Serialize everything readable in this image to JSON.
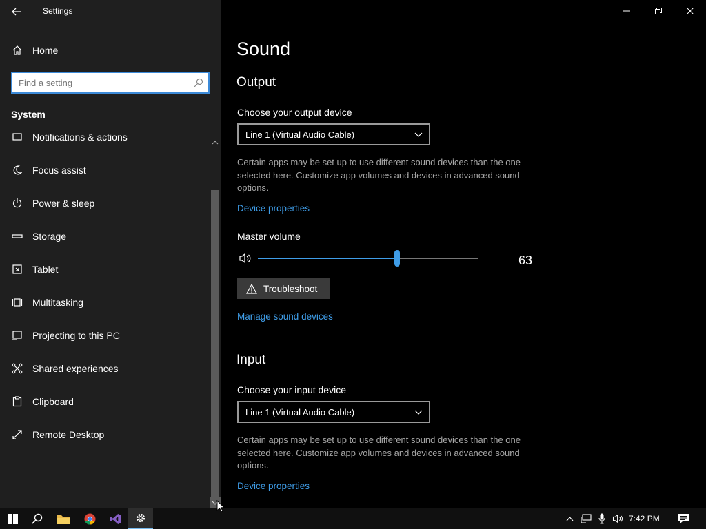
{
  "window": {
    "title": "Settings",
    "colors": {
      "accent": "#3f9de8",
      "sidebar_bg": "#1f1f1f",
      "main_bg": "#000000",
      "search_border": "#3c8ad8"
    }
  },
  "sidebar": {
    "home_label": "Home",
    "search_placeholder": "Find a setting",
    "section_title": "System",
    "items": [
      {
        "label": "Notifications & actions",
        "icon": "notifications-icon"
      },
      {
        "label": "Focus assist",
        "icon": "moon-icon"
      },
      {
        "label": "Power & sleep",
        "icon": "power-icon"
      },
      {
        "label": "Storage",
        "icon": "storage-icon"
      },
      {
        "label": "Tablet",
        "icon": "tablet-icon"
      },
      {
        "label": "Multitasking",
        "icon": "multitasking-icon"
      },
      {
        "label": "Projecting to this PC",
        "icon": "projecting-icon"
      },
      {
        "label": "Shared experiences",
        "icon": "shared-experiences-icon"
      },
      {
        "label": "Clipboard",
        "icon": "clipboard-icon"
      },
      {
        "label": "Remote Desktop",
        "icon": "remote-desktop-icon"
      }
    ]
  },
  "main": {
    "page_title": "Sound",
    "output": {
      "title": "Output",
      "device_label": "Choose your output device",
      "device_value": "Line 1 (Virtual Audio Cable)",
      "description": "Certain apps may be set up to use different sound devices than the one selected here. Customize app volumes and devices in advanced sound options.",
      "device_properties_link": "Device properties",
      "master_volume_label": "Master volume",
      "master_volume_value": "63",
      "volume_level": 0.63,
      "troubleshoot_label": "Troubleshoot",
      "manage_devices_link": "Manage sound devices"
    },
    "input": {
      "title": "Input",
      "device_label": "Choose your input device",
      "device_value": "Line 1 (Virtual Audio Cable)",
      "description": "Certain apps may be set up to use different sound devices than the one selected here. Customize app volumes and devices in advanced sound options.",
      "device_properties_link": "Device properties"
    }
  },
  "taskbar": {
    "clock": "7:42 PM",
    "apps": [
      "start-icon",
      "search-icon",
      "file-explorer-icon",
      "chrome-icon",
      "visual-studio-icon",
      "settings-icon"
    ]
  }
}
